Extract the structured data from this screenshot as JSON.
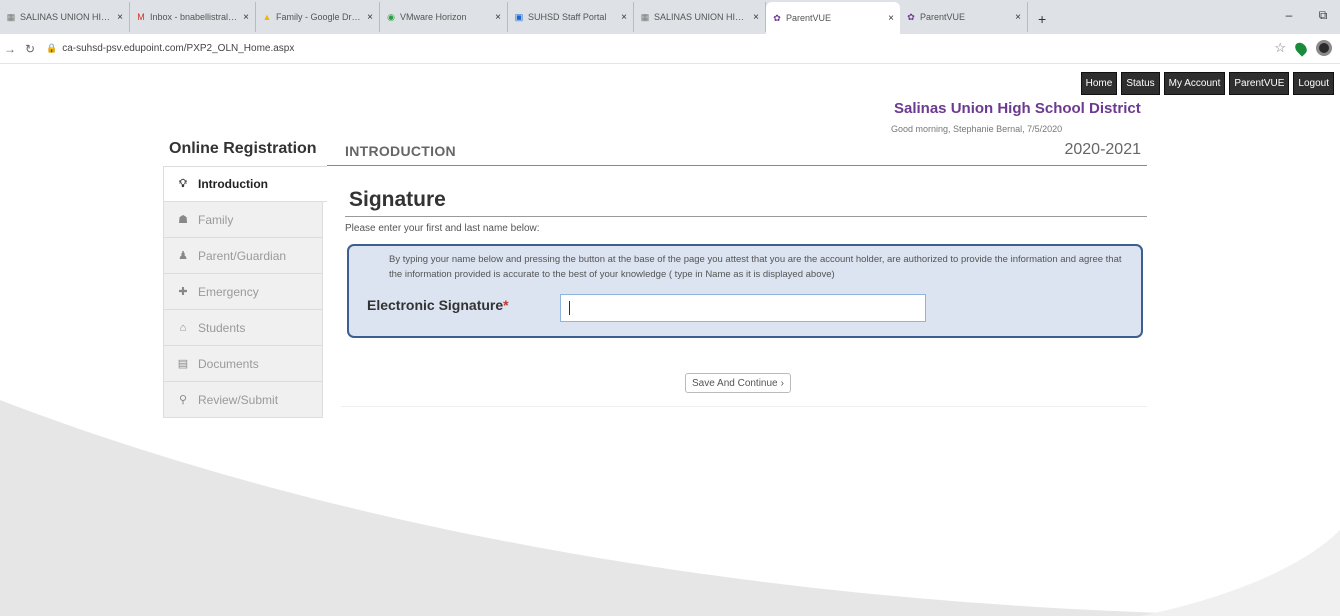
{
  "browser": {
    "tabs": [
      {
        "title": "SALINAS UNION HIGH SCH",
        "icon": "school-icon",
        "active": false
      },
      {
        "title": "Inbox - bnabellistraloud",
        "icon": "gmail-icon",
        "active": false
      },
      {
        "title": "Family - Google Drive",
        "icon": "drive-icon",
        "active": false
      },
      {
        "title": "VMware Horizon",
        "icon": "vmware-icon",
        "active": false
      },
      {
        "title": "SUHSD Staff Portal",
        "icon": "portal-icon",
        "active": false
      },
      {
        "title": "SALINAS UNION HIGH SCH",
        "icon": "school-icon",
        "active": false
      },
      {
        "title": "ParentVUE",
        "icon": "parentvue-icon",
        "active": true
      },
      {
        "title": "ParentVUE",
        "icon": "parentvue-icon",
        "active": false
      }
    ],
    "new_tab": "+",
    "url": "ca-suhsd-psv.edupoint.com/PXP2_OLN_Home.aspx",
    "window_controls": {
      "minimize": "–",
      "restore": "⧉"
    }
  },
  "topnav": [
    "Home",
    "Status",
    "My Account",
    "ParentVUE",
    "Logout"
  ],
  "district": {
    "name": "Salinas Union High School District",
    "greeting": "Good morning, Stephanie Bernal, 7/5/2020"
  },
  "sidebar": {
    "title": "Online Registration",
    "items": [
      {
        "label": "Introduction",
        "icon": "lightbulb-icon",
        "active": true
      },
      {
        "label": "Family",
        "icon": "family-icon",
        "active": false
      },
      {
        "label": "Parent/Guardian",
        "icon": "user-icon",
        "active": false
      },
      {
        "label": "Emergency",
        "icon": "medkit-icon",
        "active": false
      },
      {
        "label": "Students",
        "icon": "students-icon",
        "active": false
      },
      {
        "label": "Documents",
        "icon": "document-icon",
        "active": false
      },
      {
        "label": "Review/Submit",
        "icon": "search-icon",
        "active": false
      }
    ]
  },
  "content": {
    "section": "INTRODUCTION",
    "year": "2020-2021",
    "title": "Signature",
    "instructions": "Please enter your first and last name below:",
    "attestation": "By typing your name below and pressing the button at the base of the page you attest that you are the account holder, are authorized to provide the information and agree that the information provided is accurate to the best of your knowledge ( type in Name as it is displayed above)",
    "signature_label": "Electronic Signature",
    "required_mark": "*",
    "signature_value": "",
    "save_label": "Save And Continue"
  }
}
